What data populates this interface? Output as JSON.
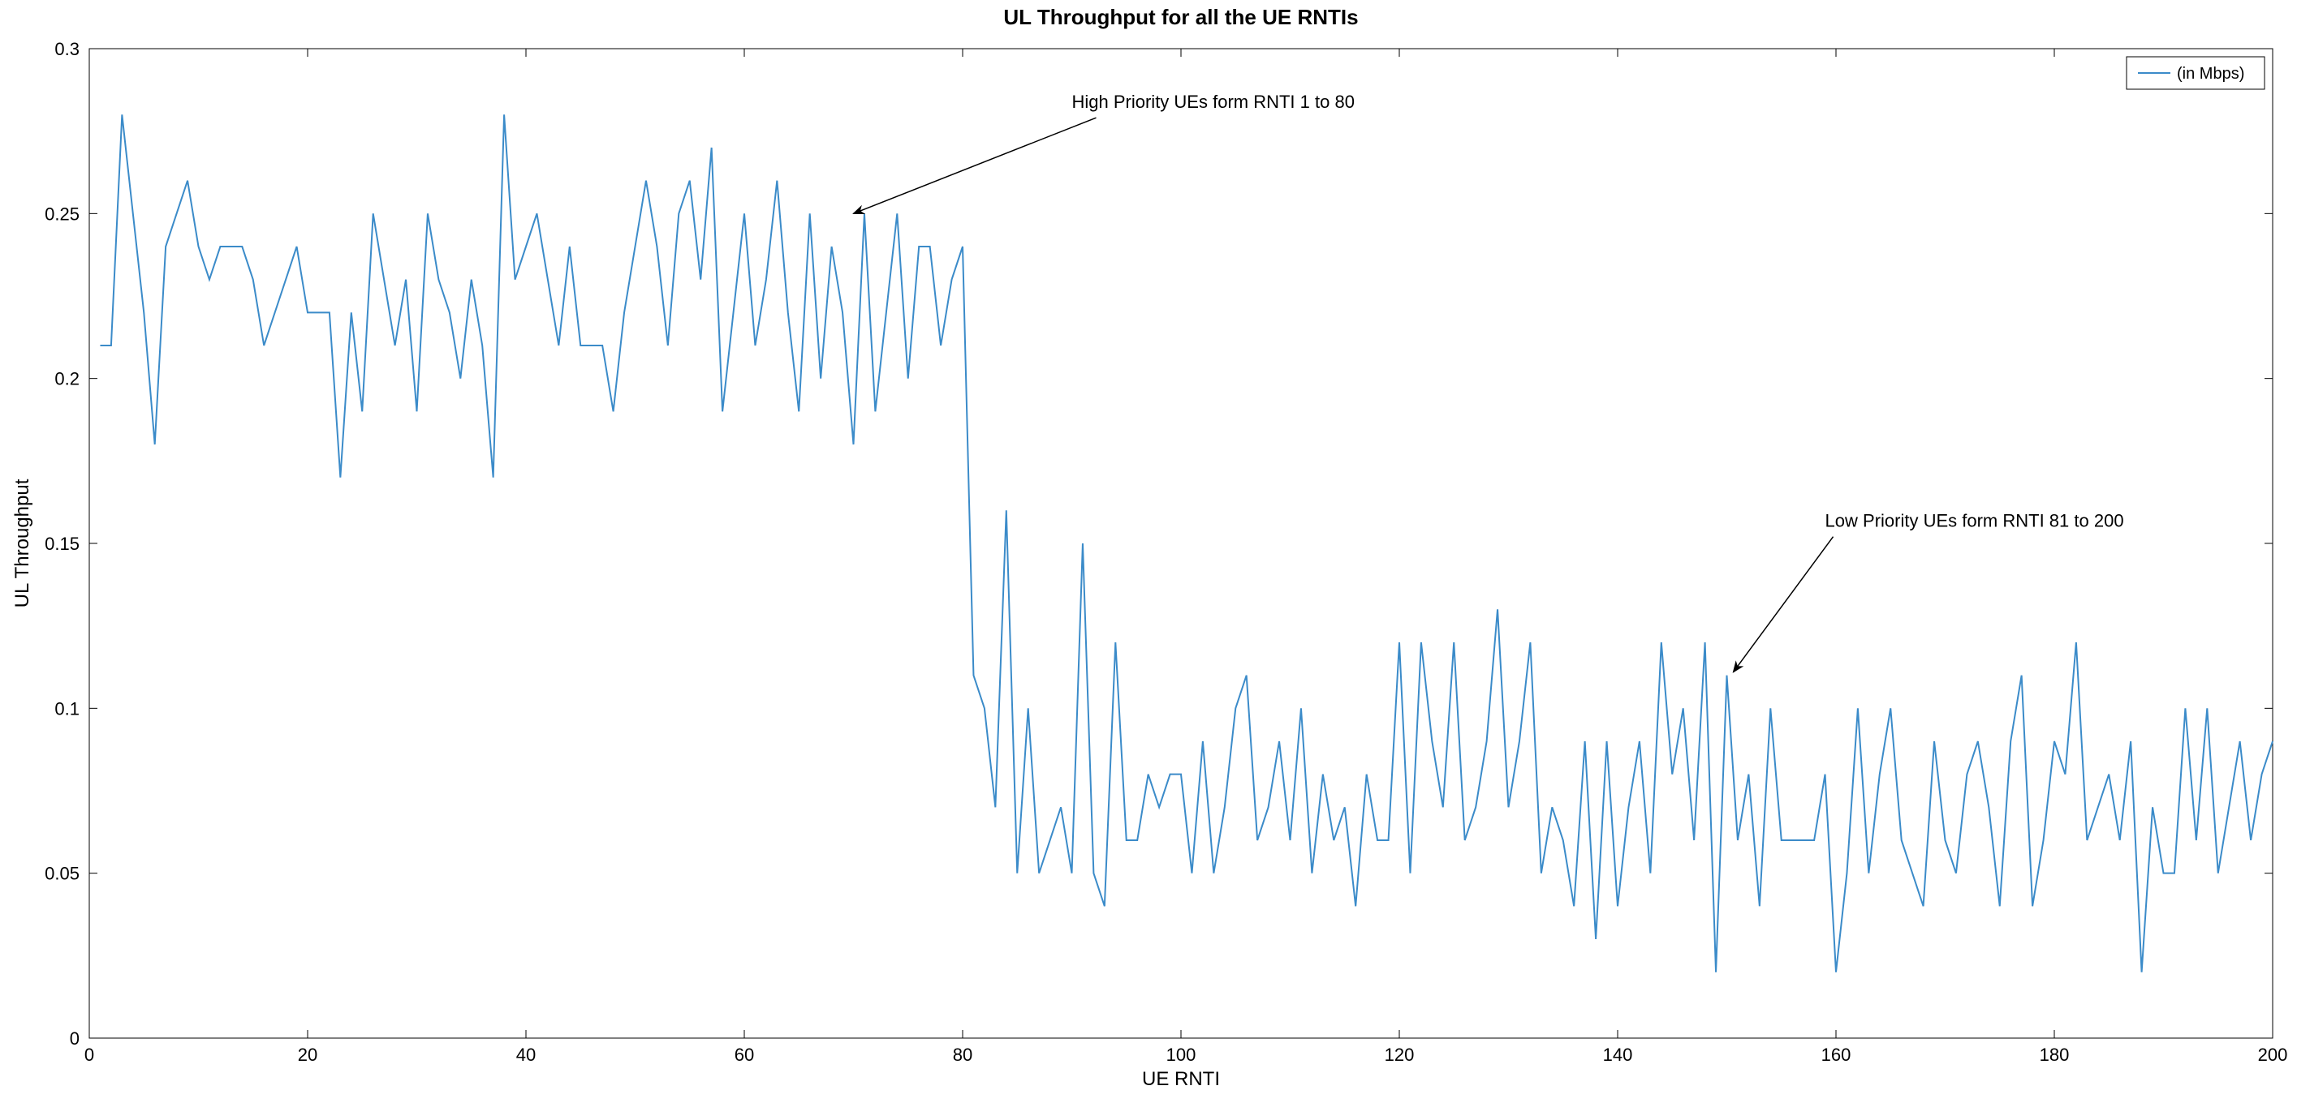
{
  "chart_data": {
    "type": "line",
    "title": "UL Throughput for all the UE RNTIs",
    "xlabel": "UE RNTI",
    "ylabel": "UL Throughput",
    "xlim": [
      0,
      200
    ],
    "ylim": [
      0,
      0.3
    ],
    "xticks": [
      0,
      20,
      40,
      60,
      80,
      100,
      120,
      140,
      160,
      180,
      200
    ],
    "yticks": [
      0,
      0.05,
      0.1,
      0.15,
      0.2,
      0.25,
      0.3
    ],
    "legend": {
      "label": "(in Mbps)"
    },
    "annotations": [
      {
        "text": "High Priority UEs form RNTI 1 to 80",
        "arrow_to_x": 70,
        "arrow_to_y": 0.25
      },
      {
        "text": "Low Priority UEs form RNTI 81 to 200",
        "arrow_to_x": 150,
        "arrow_to_y": 0.11
      }
    ],
    "x": [
      1,
      2,
      3,
      4,
      5,
      6,
      7,
      8,
      9,
      10,
      11,
      12,
      13,
      14,
      15,
      16,
      17,
      18,
      19,
      20,
      21,
      22,
      23,
      24,
      25,
      26,
      27,
      28,
      29,
      30,
      31,
      32,
      33,
      34,
      35,
      36,
      37,
      38,
      39,
      40,
      41,
      42,
      43,
      44,
      45,
      46,
      47,
      48,
      49,
      50,
      51,
      52,
      53,
      54,
      55,
      56,
      57,
      58,
      59,
      60,
      61,
      62,
      63,
      64,
      65,
      66,
      67,
      68,
      69,
      70,
      71,
      72,
      73,
      74,
      75,
      76,
      77,
      78,
      79,
      80,
      81,
      82,
      83,
      84,
      85,
      86,
      87,
      88,
      89,
      90,
      91,
      92,
      93,
      94,
      95,
      96,
      97,
      98,
      99,
      100,
      101,
      102,
      103,
      104,
      105,
      106,
      107,
      108,
      109,
      110,
      111,
      112,
      113,
      114,
      115,
      116,
      117,
      118,
      119,
      120,
      121,
      122,
      123,
      124,
      125,
      126,
      127,
      128,
      129,
      130,
      131,
      132,
      133,
      134,
      135,
      136,
      137,
      138,
      139,
      140,
      141,
      142,
      143,
      144,
      145,
      146,
      147,
      148,
      149,
      150,
      151,
      152,
      153,
      154,
      155,
      156,
      157,
      158,
      159,
      160,
      161,
      162,
      163,
      164,
      165,
      166,
      167,
      168,
      169,
      170,
      171,
      172,
      173,
      174,
      175,
      176,
      177,
      178,
      179,
      180,
      181,
      182,
      183,
      184,
      185,
      186,
      187,
      188,
      189,
      190,
      191,
      192,
      193,
      194,
      195,
      196,
      197,
      198,
      199,
      200
    ],
    "values": [
      0.21,
      0.21,
      0.28,
      0.25,
      0.22,
      0.18,
      0.24,
      0.25,
      0.26,
      0.24,
      0.23,
      0.24,
      0.24,
      0.24,
      0.23,
      0.21,
      0.22,
      0.23,
      0.24,
      0.22,
      0.22,
      0.22,
      0.17,
      0.22,
      0.19,
      0.25,
      0.23,
      0.21,
      0.23,
      0.19,
      0.25,
      0.23,
      0.22,
      0.2,
      0.23,
      0.21,
      0.17,
      0.28,
      0.23,
      0.24,
      0.25,
      0.23,
      0.21,
      0.24,
      0.21,
      0.21,
      0.21,
      0.19,
      0.22,
      0.24,
      0.26,
      0.24,
      0.21,
      0.25,
      0.26,
      0.23,
      0.27,
      0.19,
      0.22,
      0.25,
      0.21,
      0.23,
      0.26,
      0.22,
      0.19,
      0.25,
      0.2,
      0.24,
      0.22,
      0.18,
      0.25,
      0.19,
      0.22,
      0.25,
      0.2,
      0.24,
      0.24,
      0.21,
      0.23,
      0.24,
      0.11,
      0.1,
      0.07,
      0.16,
      0.05,
      0.1,
      0.05,
      0.06,
      0.07,
      0.05,
      0.15,
      0.05,
      0.04,
      0.12,
      0.06,
      0.06,
      0.08,
      0.07,
      0.08,
      0.08,
      0.05,
      0.09,
      0.05,
      0.07,
      0.1,
      0.11,
      0.06,
      0.07,
      0.09,
      0.06,
      0.1,
      0.05,
      0.08,
      0.06,
      0.07,
      0.04,
      0.08,
      0.06,
      0.06,
      0.12,
      0.05,
      0.12,
      0.09,
      0.07,
      0.12,
      0.06,
      0.07,
      0.09,
      0.13,
      0.07,
      0.09,
      0.12,
      0.05,
      0.07,
      0.06,
      0.04,
      0.09,
      0.03,
      0.09,
      0.04,
      0.07,
      0.09,
      0.05,
      0.12,
      0.08,
      0.1,
      0.06,
      0.12,
      0.02,
      0.11,
      0.06,
      0.08,
      0.04,
      0.1,
      0.06,
      0.06,
      0.06,
      0.06,
      0.08,
      0.02,
      0.05,
      0.1,
      0.05,
      0.08,
      0.1,
      0.06,
      0.05,
      0.04,
      0.09,
      0.06,
      0.05,
      0.08,
      0.09,
      0.07,
      0.04,
      0.09,
      0.11,
      0.04,
      0.06,
      0.09,
      0.08,
      0.12,
      0.06,
      0.07,
      0.08,
      0.06,
      0.09,
      0.02,
      0.07,
      0.05,
      0.05,
      0.1,
      0.06,
      0.1,
      0.05,
      0.07,
      0.09,
      0.06,
      0.08,
      0.09
    ]
  }
}
